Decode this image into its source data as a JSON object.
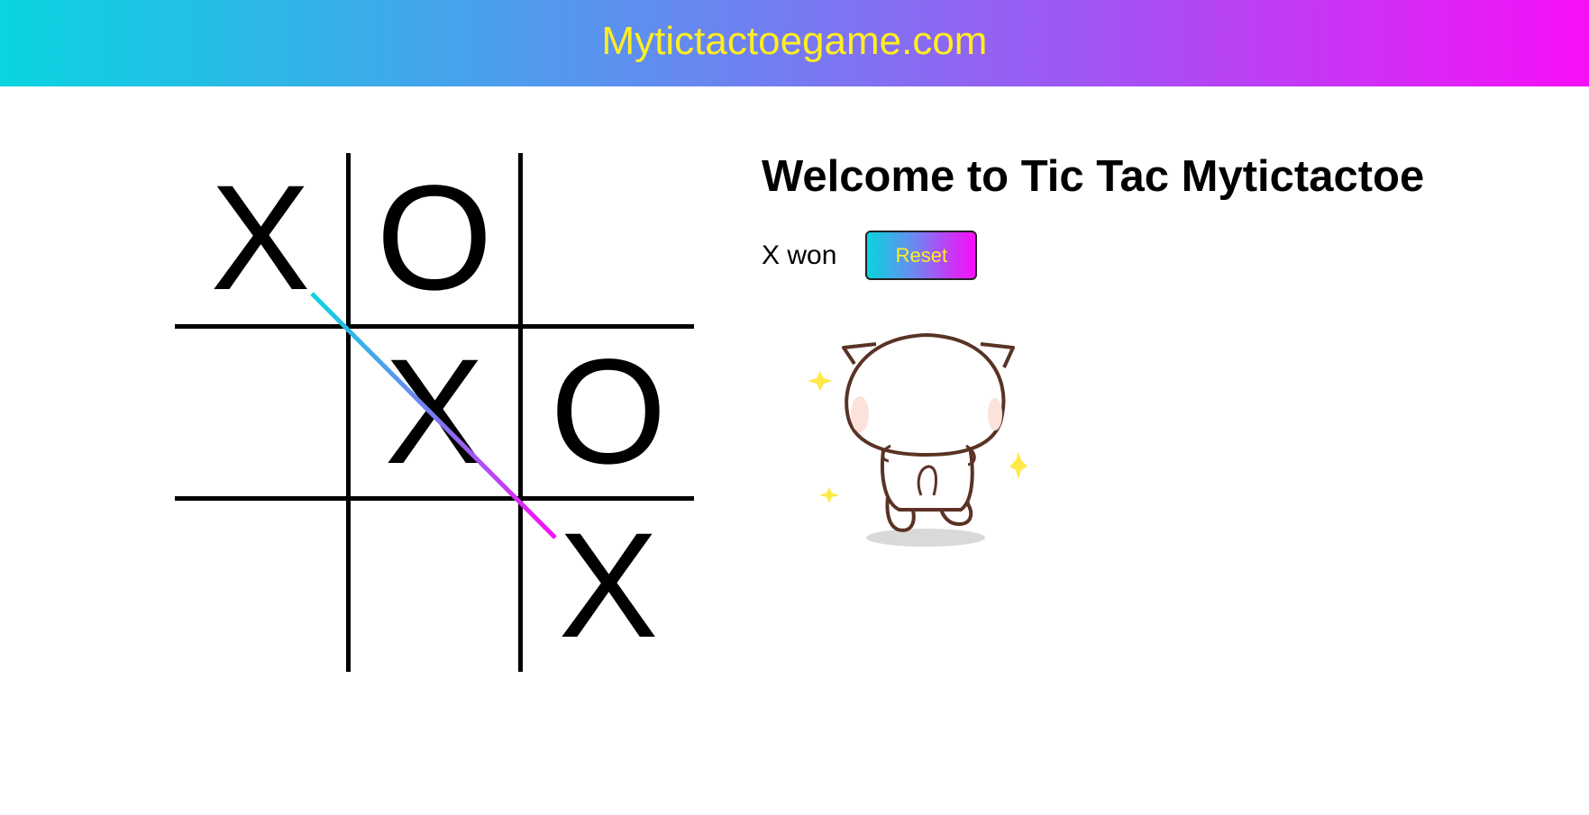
{
  "header": {
    "title": "Mytictactoegame.com"
  },
  "board": {
    "cells": [
      "X",
      "O",
      "",
      "",
      "X",
      "O",
      "",
      "",
      "X"
    ]
  },
  "info": {
    "title": "Welcome to Tic Tac Mytictactoe",
    "status": "X won",
    "reset_label": "Reset"
  },
  "colors": {
    "gradient_start": "#0ad4e0",
    "gradient_end": "#f70ff8",
    "header_text": "#ffee22",
    "sparkle": "#ffe94a",
    "cat_outline": "#5a3325"
  },
  "icons": {
    "celebration": "walking-cat-sticker"
  }
}
